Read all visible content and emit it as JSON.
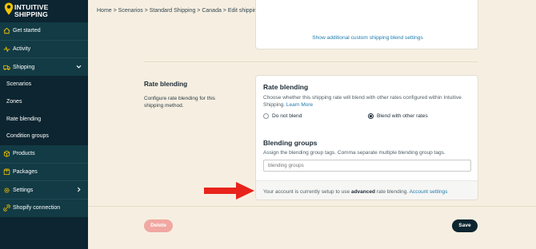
{
  "brand": {
    "line1": "INTUITIVE",
    "line2": "SHIPPING",
    "pin_color": "#f3c300"
  },
  "sidebar": {
    "items": [
      {
        "label": "Get started",
        "icon": "home-icon"
      },
      {
        "label": "Activity",
        "icon": "activity-icon"
      },
      {
        "label": "Shipping",
        "icon": "truck-icon",
        "expanded": true
      },
      {
        "label": "Scenarios"
      },
      {
        "label": "Zones"
      },
      {
        "label": "Rate blending"
      },
      {
        "label": "Condition groups"
      },
      {
        "label": "Products",
        "icon": "products-icon"
      },
      {
        "label": "Packages",
        "icon": "package-icon"
      },
      {
        "label": "Settings",
        "icon": "gear-icon"
      },
      {
        "label": "Shopify connection",
        "icon": "connection-icon"
      }
    ]
  },
  "breadcrumb": "Home > Scenarios > Standard Shipping > Canada > Edit shipping method",
  "top_card": {
    "link": "Show additional custom shipping blend settings"
  },
  "section": {
    "title": "Rate blending",
    "description": "Configure rate blending for this shipping method."
  },
  "rate_blending": {
    "title": "Rate blending",
    "description": "Choose whether this shipping rate will blend with other rates configured within Intuitive Shipping.",
    "learn_more": "Learn More",
    "options": [
      {
        "label": "Do not blend",
        "selected": false
      },
      {
        "label": "Blend with other rates",
        "selected": true
      }
    ]
  },
  "blending_groups": {
    "title": "Blending groups",
    "description": "Assign the blending group tags. Comma separate multiple blending group tags.",
    "placeholder": "blending groups",
    "value": ""
  },
  "account_note": {
    "prefix": "Your account is currently setup to use",
    "bold": "advanced",
    "suffix": "rate blending.",
    "link": "Account settings"
  },
  "actions": {
    "delete": "Delete",
    "save": "Save"
  },
  "colors": {
    "sidebar_bg": "#0c2530",
    "accent_link": "#1e7cae",
    "page_bg": "#f6efe1",
    "delete_bg": "#f1a7a2",
    "arrow": "#e8231b"
  }
}
